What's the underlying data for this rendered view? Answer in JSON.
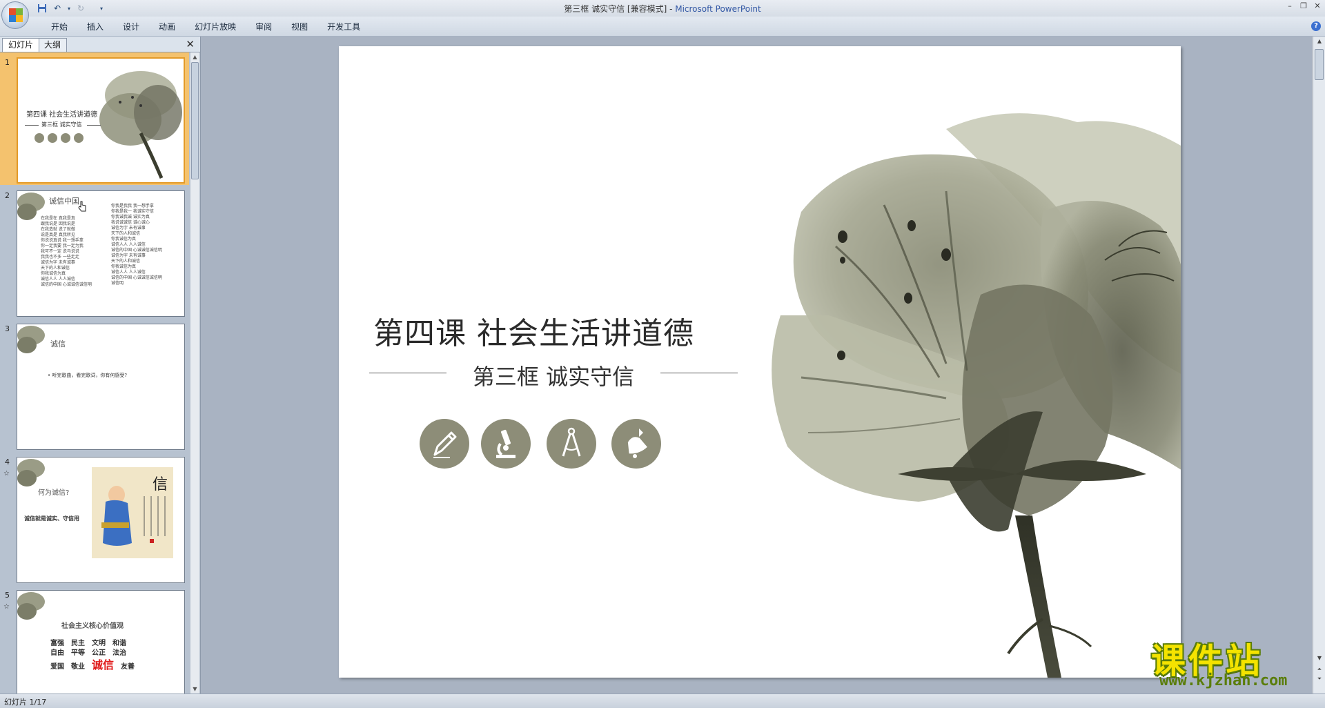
{
  "window": {
    "title": "第三框  诚实守信 [兼容模式] - ",
    "app_name": "Microsoft PowerPoint"
  },
  "ribbon": {
    "tabs": [
      "开始",
      "插入",
      "设计",
      "动画",
      "幻灯片放映",
      "审阅",
      "视图",
      "开发工具"
    ]
  },
  "left_pane": {
    "tabs": [
      "幻灯片",
      "大纲"
    ],
    "close_label": "✕",
    "thumbnails": [
      {
        "number": "1",
        "title": "第四课  社会生活讲道德",
        "subtitle": "第三框  诚实守信"
      },
      {
        "number": "2",
        "title": "诚信中国",
        "col1": [
          "在我是在 真我是真",
          "跟我说是 因我说是",
          "在我造就 说了就做",
          "说是真是 真我所见",
          "",
          "你说说真说 我一想手拿",
          "你一定我要 我一定为我",
          "我可不一定 说马说说",
          "我我也不多 一些走走",
          "",
          "诚信为字 未有诚事",
          "天下的人和诚信",
          "你我诚信为真",
          "诚信人人 人人诚信",
          "诚信的中国 心诚诚信诚信明"
        ],
        "col2": [
          "你我是我我 我一想手拿",
          "你我是我一 我诚实守信",
          "你我诚我诚 诚实为真",
          "我说诚诚信 诚心诚心",
          "",
          "诚信为字 未有诚事",
          "天下的人和诚信",
          "你我诚信为真",
          "诚信人人 人人诚信",
          "诚信的中国 心诚诚信诚信明",
          "",
          "诚信为字 未有诚事",
          "天下的人和诚信",
          "你我诚信为真",
          "诚信人人 人人诚信",
          "诚信的中国 心诚诚信诚信明",
          "诚信明"
        ]
      },
      {
        "number": "3",
        "title": "诚信",
        "bullet": "• 听完歌曲，看完歌词，你有何感受?"
      },
      {
        "number": "4",
        "title": "何为诚信?",
        "text": "诚信就是诚实、守信用"
      },
      {
        "number": "5",
        "title": "社会主义核心价值观",
        "rows": [
          [
            "富强",
            "民主",
            "文明",
            "和谐"
          ],
          [
            "自由",
            "平等",
            "公正",
            "法治"
          ],
          [
            "爱国",
            "敬业",
            "诚信",
            "友善"
          ]
        ]
      }
    ]
  },
  "slide": {
    "title": "第四课  社会生活讲道德",
    "subtitle": "第三框  诚实守信",
    "icons": [
      "pencil-icon",
      "microscope-icon",
      "compass-icon",
      "bell-icon"
    ]
  },
  "status": {
    "text": "幻灯片 1/17"
  },
  "watermark": {
    "text": "课件站",
    "url": "www.kjzhan.com"
  },
  "colors": {
    "icon_circle": "#8d8d78",
    "flower_dark": "#3e4032",
    "flower_light": "#a6a891",
    "selection": "#f4c26e",
    "highlight_red": "#e01818"
  }
}
